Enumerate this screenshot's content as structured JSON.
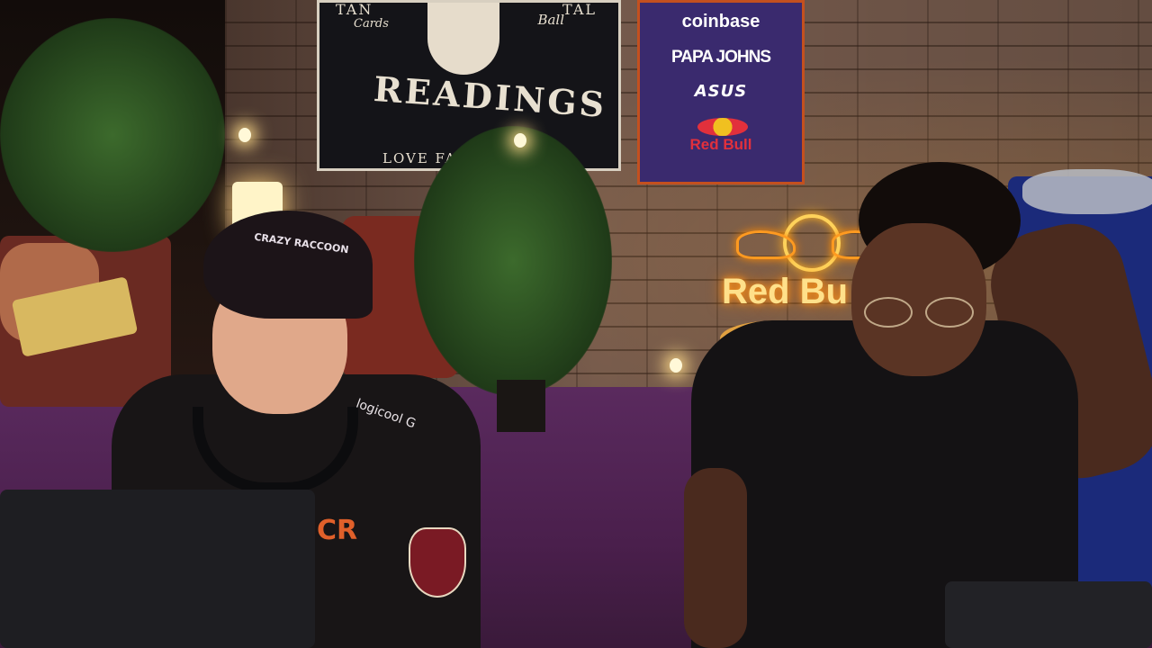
{
  "scene": {
    "tapestry": {
      "top_left": "TAN",
      "top_right": "TAL",
      "cards": "Cards",
      "ball": "Ball",
      "title": "READINGS",
      "bottom": "LOVE  FATE"
    },
    "sponsor_banner": {
      "sponsors": [
        "coinbase",
        "PAPA JOHNS",
        "ASUS",
        "Red Bull"
      ]
    },
    "neon_sign": {
      "text": "Red Bu"
    },
    "cap_text": "CRAZY RACCOON",
    "jacket_text": "logicool G",
    "jacket_logo": "CR",
    "colors": {
      "floor": "#4a1f4c",
      "banner_bg": "#3a2a6e",
      "banner_border": "#c3501f",
      "neon": "#ffb020",
      "cooler": "#1b2a7a"
    }
  }
}
